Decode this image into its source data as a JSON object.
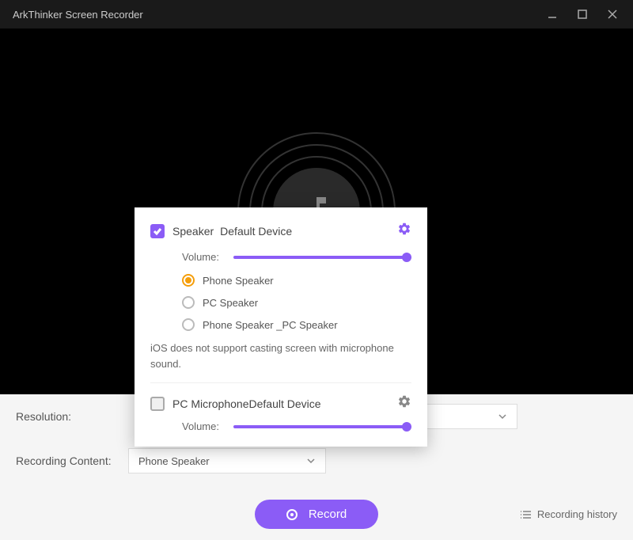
{
  "titlebar": {
    "title": "ArkThinker Screen Recorder"
  },
  "settings": {
    "resolution_label": "Resolution:",
    "content_label": "Recording Content:",
    "content_value": "Phone Speaker"
  },
  "record_button": "Record",
  "history_link": "Recording history",
  "popup": {
    "speaker": {
      "checked": true,
      "label": "Speaker",
      "device": "Default Device",
      "volume_label": "Volume:",
      "options": [
        {
          "label": "Phone Speaker",
          "selected": true
        },
        {
          "label": "PC Speaker",
          "selected": false
        },
        {
          "label": "Phone Speaker _PC Speaker",
          "selected": false
        }
      ]
    },
    "info": "iOS does not support casting screen with microphone sound.",
    "mic": {
      "checked": false,
      "label": "PC Microphone",
      "device": "Default Device",
      "volume_label": "Volume:"
    }
  }
}
